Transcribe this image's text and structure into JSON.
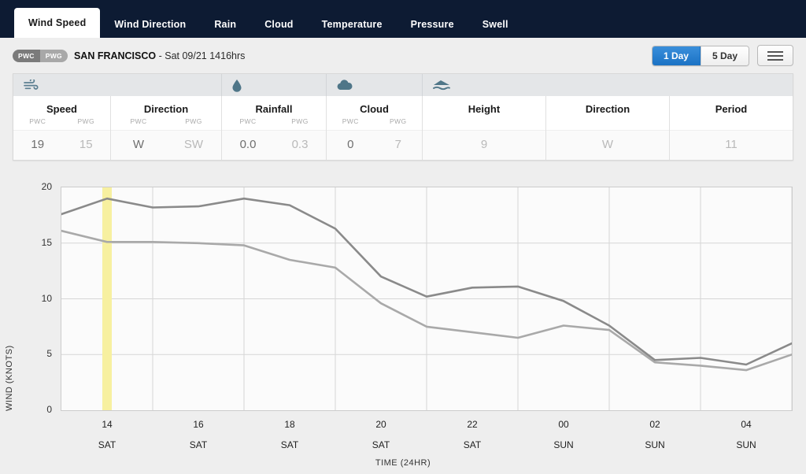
{
  "tabs": [
    {
      "label": "Wind Speed",
      "active": true
    },
    {
      "label": "Wind Direction",
      "active": false
    },
    {
      "label": "Rain",
      "active": false
    },
    {
      "label": "Cloud",
      "active": false
    },
    {
      "label": "Temperature",
      "active": false
    },
    {
      "label": "Pressure",
      "active": false
    },
    {
      "label": "Swell",
      "active": false
    }
  ],
  "location": {
    "badge_pwc": "PWC",
    "badge_pwg": "PWG",
    "name": "SAN FRANCISCO",
    "separator": " - ",
    "timestamp": "Sat 09/21 1416hrs"
  },
  "range_toggle": {
    "one_day": "1 Day",
    "five_day": "5 Day",
    "selected": "1 Day",
    "active_color": "#1b72c4"
  },
  "menu_button": "menu",
  "summary": {
    "icon_groups": [
      {
        "icon": "wind-icon",
        "span": 2
      },
      {
        "icon": "raindrop-icon",
        "span": 1
      },
      {
        "icon": "cloud-icon",
        "span": 1
      },
      {
        "icon": "swell-wave-icon",
        "span": 3
      }
    ],
    "columns": [
      {
        "title": "Speed",
        "sub": [
          "PWC",
          "PWG"
        ],
        "values": [
          "19",
          "15"
        ]
      },
      {
        "title": "Direction",
        "sub": [
          "PWC",
          "PWG"
        ],
        "values": [
          "W",
          "SW"
        ]
      },
      {
        "title": "Rainfall",
        "sub": [
          "PWC",
          "PWG"
        ],
        "values": [
          "0.0",
          "0.3"
        ]
      },
      {
        "title": "Cloud",
        "sub": [
          "PWC",
          "PWG"
        ],
        "values": [
          "0",
          "7"
        ]
      },
      {
        "title": "Height",
        "sub": [],
        "values": [
          "9"
        ]
      },
      {
        "title": "Direction",
        "sub": [],
        "values": [
          "W"
        ]
      },
      {
        "title": "Period",
        "sub": [],
        "values": [
          "11"
        ]
      }
    ]
  },
  "chart_data": {
    "type": "line",
    "title": "",
    "xlabel": "TIME (24HR)",
    "ylabel": "WIND (KNOTS)",
    "ylim": [
      0,
      20
    ],
    "yticks": [
      0,
      5,
      10,
      15,
      20
    ],
    "grid": true,
    "legend": "none",
    "line_color": "#8d8d8d",
    "highlight": {
      "label": "current time",
      "x_hour": 14.3,
      "color": "#f7f0a0"
    },
    "xticks": [
      {
        "time": "14",
        "day": "SAT"
      },
      {
        "time": "16",
        "day": "SAT"
      },
      {
        "time": "18",
        "day": "SAT"
      },
      {
        "time": "20",
        "day": "SAT"
      },
      {
        "time": "22",
        "day": "SAT"
      },
      {
        "time": "00",
        "day": "SUN"
      },
      {
        "time": "02",
        "day": "SUN"
      },
      {
        "time": "04",
        "day": "SUN"
      }
    ],
    "x": [
      13,
      14,
      15,
      16,
      17,
      18,
      19,
      20,
      21,
      22,
      23,
      0,
      1,
      2,
      3,
      4,
      5
    ],
    "series": [
      {
        "name": "PWC",
        "color": "#8a8a8a",
        "values": [
          17.6,
          19.0,
          18.2,
          18.3,
          19.0,
          18.4,
          16.3,
          12.0,
          10.2,
          11.0,
          11.1,
          9.8,
          7.6,
          4.5,
          4.7,
          4.1,
          6.0
        ]
      },
      {
        "name": "PWG",
        "color": "#a9a9a9",
        "values": [
          16.1,
          15.1,
          15.1,
          15.0,
          14.8,
          13.5,
          12.8,
          9.6,
          7.5,
          7.0,
          6.5,
          7.6,
          7.2,
          4.3,
          4.0,
          3.6,
          5.0
        ]
      }
    ]
  }
}
